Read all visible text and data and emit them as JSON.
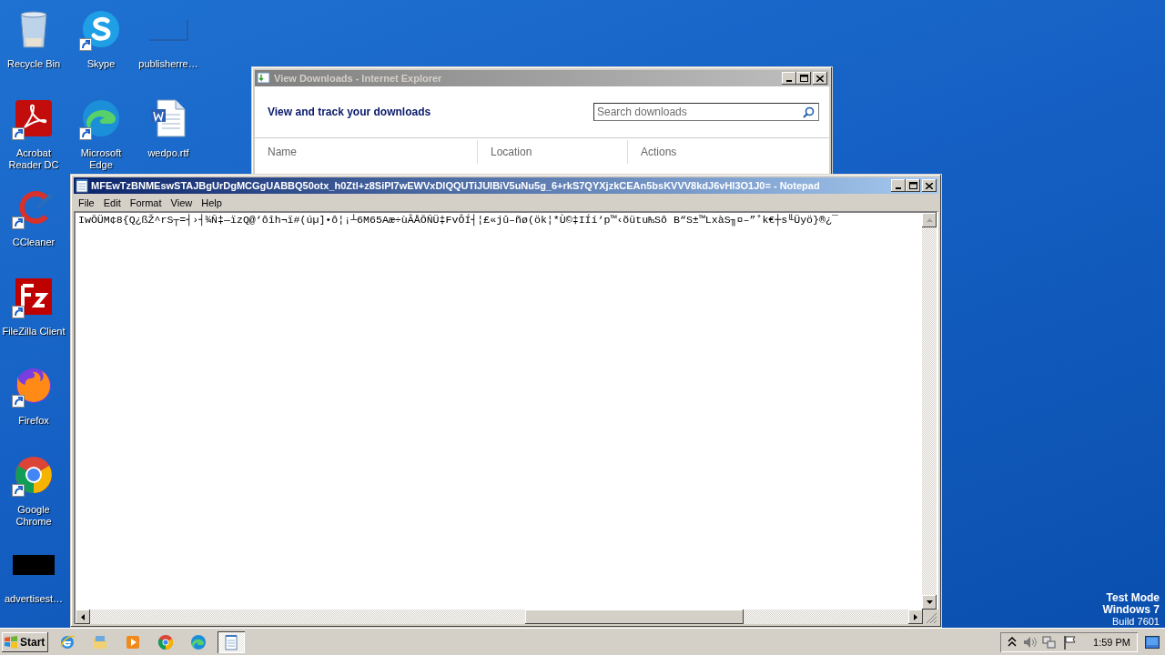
{
  "desktop": {
    "columns": [
      [
        {
          "kind": "recycle-bin",
          "label": "Recycle Bin",
          "shortcut": false
        },
        {
          "kind": "acrobat",
          "label": "Acrobat Reader DC",
          "shortcut": true
        },
        {
          "kind": "ccleaner",
          "label": "CCleaner",
          "shortcut": true
        },
        {
          "kind": "filezilla",
          "label": "FileZilla Client",
          "shortcut": true
        },
        {
          "kind": "firefox",
          "label": "Firefox",
          "shortcut": true
        },
        {
          "kind": "chrome",
          "label": "Google Chrome",
          "shortcut": true
        },
        {
          "kind": "black-thumbnail",
          "label": "advertisest…",
          "shortcut": false
        }
      ],
      [
        {
          "kind": "skype",
          "label": "Skype",
          "shortcut": true
        },
        {
          "kind": "edge",
          "label": "Microsoft Edge",
          "shortcut": true
        }
      ],
      [
        {
          "kind": "blank-thumbnail",
          "label": "publisherre…",
          "shortcut": false
        },
        {
          "kind": "word-doc",
          "label": "wedpo.rtf",
          "shortcut": false
        }
      ]
    ],
    "system_text": [
      "Test Mode",
      "Windows 7",
      "Build 7601"
    ]
  },
  "downloads_window": {
    "title": "View Downloads - Internet Explorer",
    "active": false,
    "heading": "View and track your downloads",
    "search": {
      "placeholder": "Search downloads"
    },
    "columns": [
      "Name",
      "Location",
      "Actions"
    ]
  },
  "notepad": {
    "title": "MFEwTzBNMEswSTAJBgUrDgMCGgUABBQ50otx_h0Ztl+z8SiPI7wEWVxDlQQUTiJUIBiV5uNu5g_6+rkS7QYXjzkCEAn5bsKVVV8kdJ6vHl3O1J0= - Notepad",
    "active": true,
    "menu": [
      "File",
      "Edit",
      "Format",
      "View",
      "Help"
    ],
    "lines": [
      "IwÕÜM¢8{Q¿ßŽ^rS┬=┤›┤¾Ñ‡—ïzQ@‘ôîh¬ï#(úµ]•ô¦¡┴6M65Aæ÷ùÂÅÕÑÜ‡FvÔÍ┤¦£«jû–ñø(ök¦*Ù©‡IÍí‘p™‹õütu₧Sô B“S±™LxàS╖¤–”˚k€┼s╙Üyö}®¿¯"
    ]
  },
  "taskbar": {
    "start": "Start",
    "items": [
      {
        "kind": "ie",
        "selected": false
      },
      {
        "kind": "explorer",
        "selected": false
      },
      {
        "kind": "media-player",
        "selected": false
      },
      {
        "kind": "chrome",
        "selected": false
      },
      {
        "kind": "edge",
        "selected": false
      },
      {
        "kind": "notepad",
        "selected": true
      }
    ],
    "clock": "1:59 PM"
  }
}
